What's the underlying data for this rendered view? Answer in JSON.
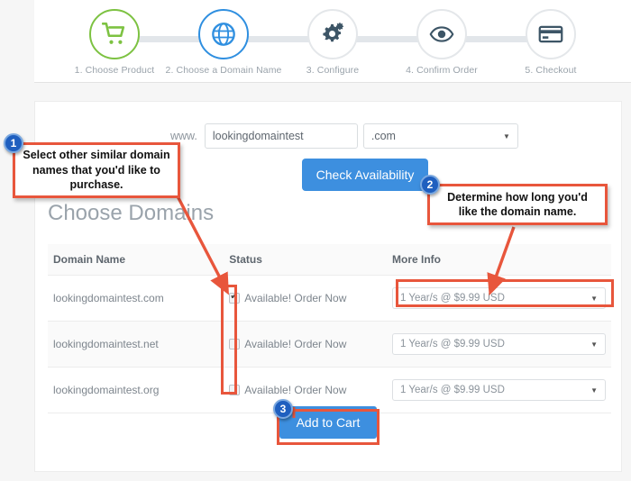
{
  "wizard": {
    "steps": [
      {
        "label": "1. Choose Product",
        "icon": "shopping-cart-icon",
        "state": "complete"
      },
      {
        "label": "2. Choose a Domain Name",
        "icon": "globe-icon",
        "state": "active"
      },
      {
        "label": "3. Configure",
        "icon": "gears-icon",
        "state": "upcoming"
      },
      {
        "label": "4. Confirm Order",
        "icon": "eye-icon",
        "state": "upcoming"
      },
      {
        "label": "5. Checkout",
        "icon": "credit-card-icon",
        "state": "upcoming"
      }
    ],
    "colors": {
      "complete": "#7dc242",
      "active": "#2f8fe0",
      "upcoming": "#e4e7ea",
      "track": "#e2e6ea"
    }
  },
  "search": {
    "www_prefix": "www.",
    "domain_value": "lookingdomaintest",
    "domain_placeholder": "lookingdomaintest",
    "tld_selected": ".com",
    "check_button": "Check Availability"
  },
  "main": {
    "section_title": "Choose Domains",
    "table": {
      "headers": [
        "Domain Name",
        "Status",
        "More Info"
      ],
      "rows": [
        {
          "domain": "lookingdomaintest.com",
          "checked": true,
          "status": "Available! Order Now",
          "more_info": "1 Year/s @ $9.99 USD"
        },
        {
          "domain": "lookingdomaintest.net",
          "checked": false,
          "status": "Available! Order Now",
          "more_info": "1 Year/s @ $9.99 USD"
        },
        {
          "domain": "lookingdomaintest.org",
          "checked": false,
          "status": "Available! Order Now",
          "more_info": "1 Year/s @ $9.99 USD"
        }
      ]
    },
    "add_to_cart": "Add to Cart"
  },
  "annotations": {
    "accent_color": "#e8563c",
    "badge_color": "#1f5fbf",
    "items": [
      {
        "number": "1",
        "text": "Select other similar domain names that you'd like to purchase."
      },
      {
        "number": "2",
        "text": "Determine how long you'd like the domain name."
      },
      {
        "number": "3",
        "text": ""
      }
    ]
  }
}
